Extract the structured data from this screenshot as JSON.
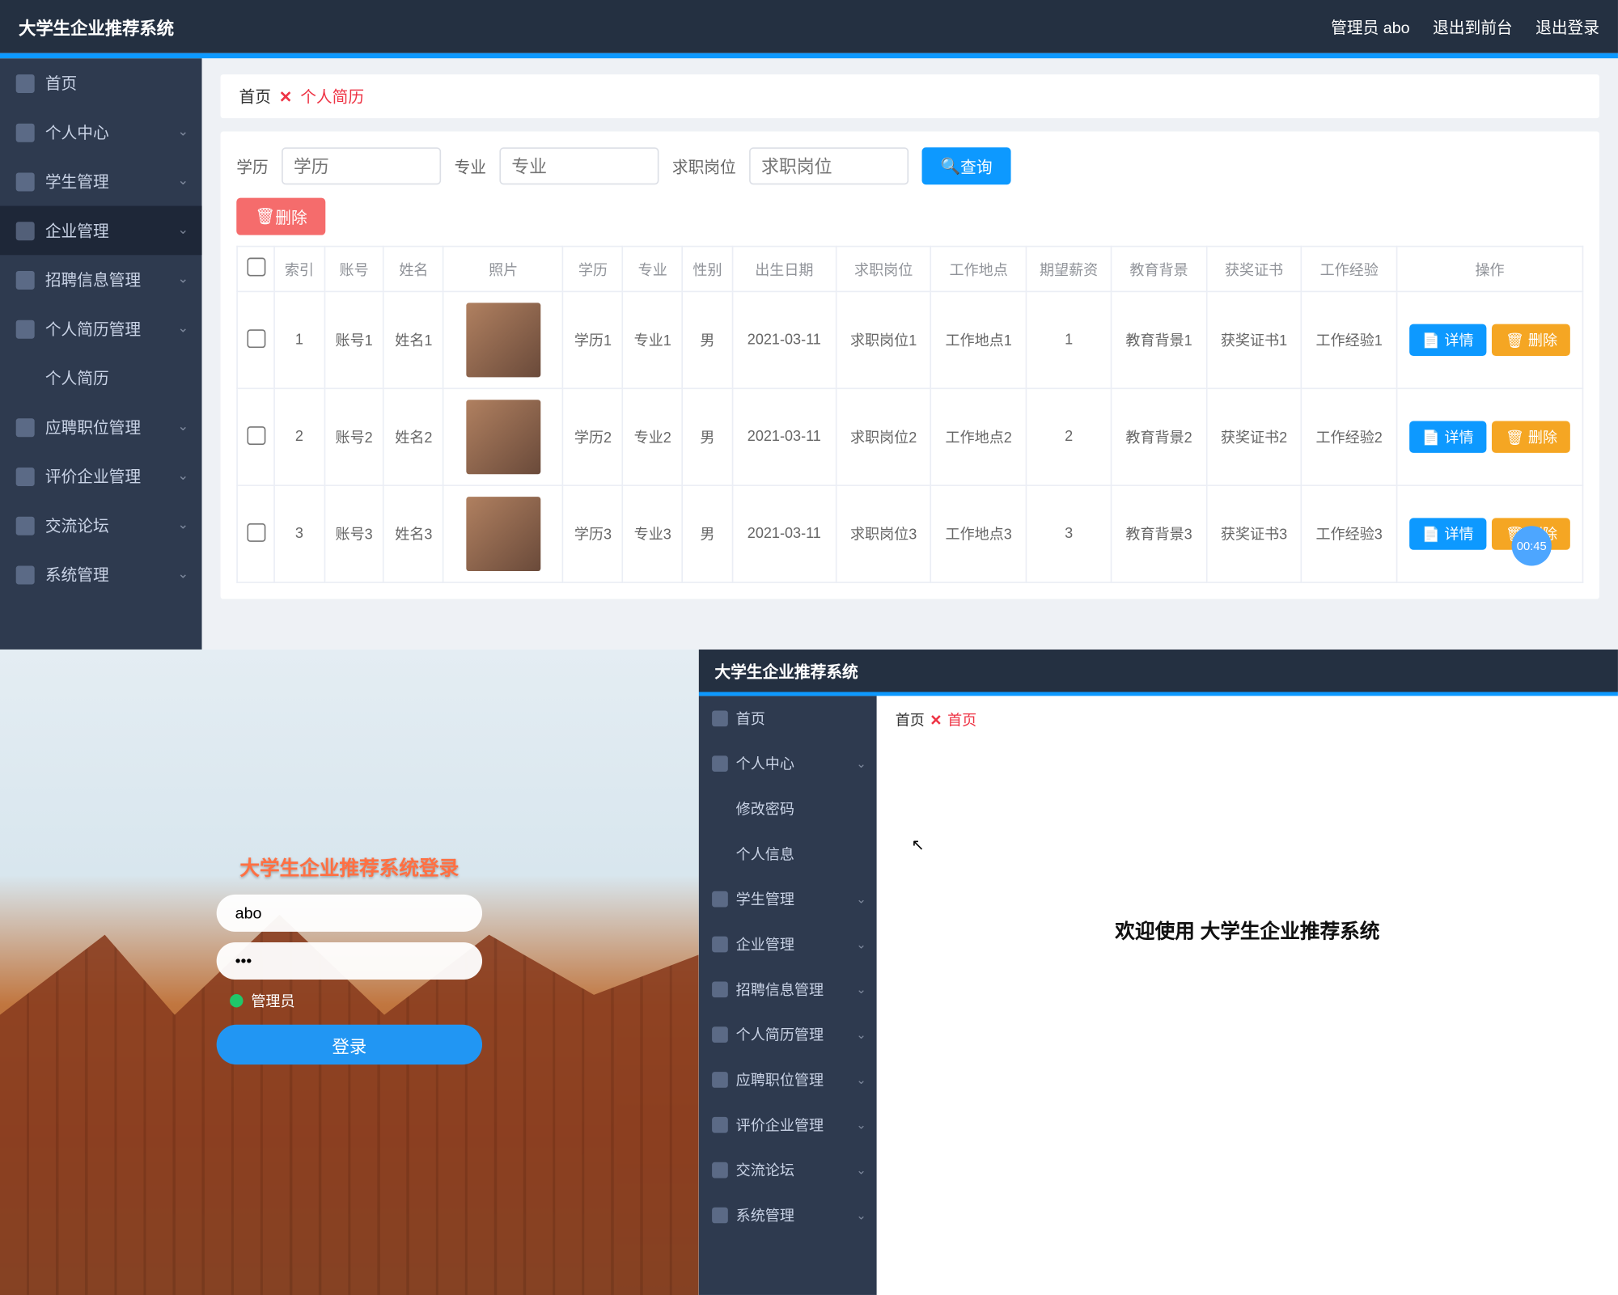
{
  "app_title": "大学生企业推荐系统",
  "header_right": {
    "admin": "管理员 abo",
    "front": "退出到前台",
    "logout": "退出登录"
  },
  "breadcrumb": {
    "home": "首页",
    "x": "✕",
    "current": "个人简历"
  },
  "sidebar": {
    "items": [
      {
        "label": "首页"
      },
      {
        "label": "个人中心"
      },
      {
        "label": "学生管理"
      },
      {
        "label": "企业管理"
      },
      {
        "label": "招聘信息管理"
      },
      {
        "label": "个人简历管理"
      },
      {
        "label": "个人简历"
      },
      {
        "label": "应聘职位管理"
      },
      {
        "label": "评价企业管理"
      },
      {
        "label": "交流论坛"
      },
      {
        "label": "系统管理"
      }
    ]
  },
  "search": {
    "f1_label": "学历",
    "f1_ph": "学历",
    "f2_label": "专业",
    "f2_ph": "专业",
    "f3_label": "求职岗位",
    "f3_ph": "求职岗位",
    "query_btn": "查询",
    "delete_btn": "删除"
  },
  "table": {
    "headers": [
      "",
      "索引",
      "账号",
      "姓名",
      "照片",
      "学历",
      "专业",
      "性别",
      "出生日期",
      "求职岗位",
      "工作地点",
      "期望薪资",
      "教育背景",
      "获奖证书",
      "工作经验",
      "操作"
    ],
    "detail_btn": "详情",
    "row_delete_btn": "删除",
    "rows": [
      {
        "idx": "1",
        "acct": "账号1",
        "name": "姓名1",
        "edu": "学历1",
        "major": "专业1",
        "gender": "男",
        "birth": "2021-03-11",
        "job": "求职岗位1",
        "place": "工作地点1",
        "salary": "1",
        "bg": "教育背景1",
        "cert": "获奖证书1",
        "exp": "工作经验1"
      },
      {
        "idx": "2",
        "acct": "账号2",
        "name": "姓名2",
        "edu": "学历2",
        "major": "专业2",
        "gender": "男",
        "birth": "2021-03-11",
        "job": "求职岗位2",
        "place": "工作地点2",
        "salary": "2",
        "bg": "教育背景2",
        "cert": "获奖证书2",
        "exp": "工作经验2"
      },
      {
        "idx": "3",
        "acct": "账号3",
        "name": "姓名3",
        "edu": "学历3",
        "major": "专业3",
        "gender": "男",
        "birth": "2021-03-11",
        "job": "求职岗位3",
        "place": "工作地点3",
        "salary": "3",
        "bg": "教育背景3",
        "cert": "获奖证书3",
        "exp": "工作经验3"
      }
    ]
  },
  "timer_badge": "00:45",
  "login": {
    "title": "大学生企业推荐系统登录",
    "user_value": "abo",
    "pass_value": "···",
    "role_label": "管理员",
    "submit": "登录"
  },
  "panel3": {
    "title": "大学生企业推荐系统",
    "breadcrumb_home": "首页",
    "breadcrumb_cur": "首页",
    "welcome": "欢迎使用 大学生企业推荐系统",
    "sidebar": [
      {
        "label": "首页"
      },
      {
        "label": "个人中心"
      },
      {
        "label": "修改密码"
      },
      {
        "label": "个人信息"
      },
      {
        "label": "学生管理"
      },
      {
        "label": "企业管理"
      },
      {
        "label": "招聘信息管理"
      },
      {
        "label": "个人简历管理"
      },
      {
        "label": "应聘职位管理"
      },
      {
        "label": "评价企业管理"
      },
      {
        "label": "交流论坛"
      },
      {
        "label": "系统管理"
      }
    ]
  }
}
